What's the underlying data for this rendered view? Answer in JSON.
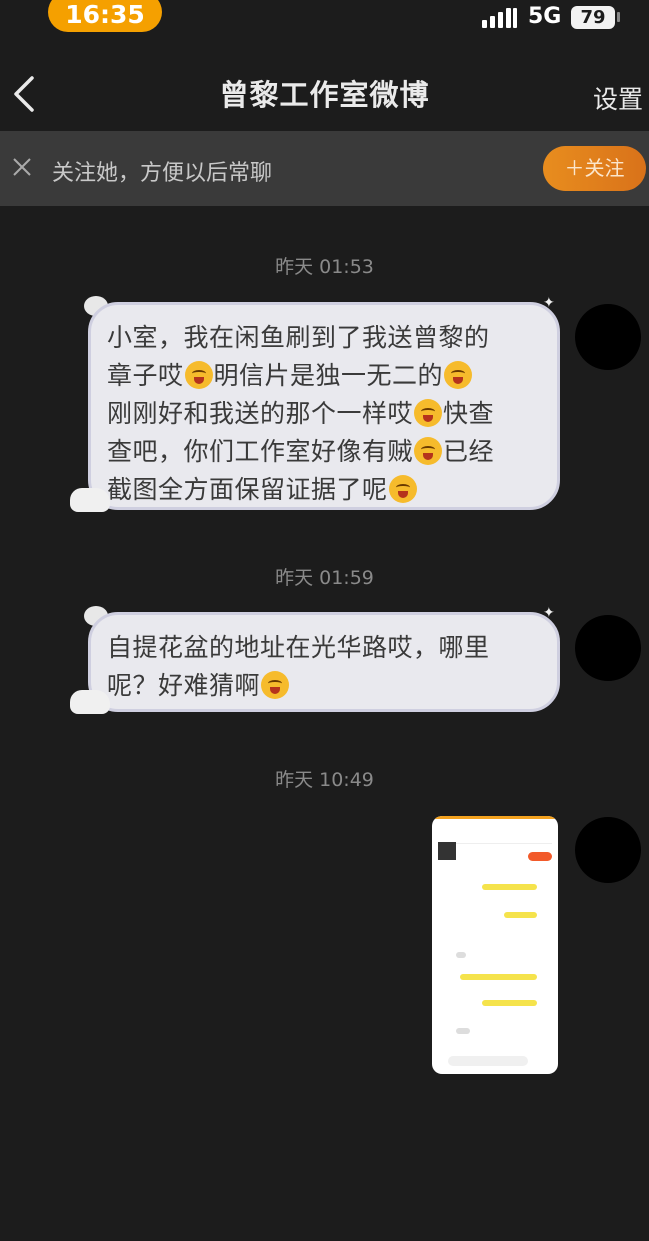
{
  "status_bar": {
    "time": "16:35",
    "network": "5G",
    "battery": "79"
  },
  "nav": {
    "title": "曾黎工作室微博",
    "settings_label": "设置"
  },
  "follow_bar": {
    "prompt": "关注她，方便以后常聊",
    "follow_label": "＋关注"
  },
  "messages": [
    {
      "timestamp": "昨天 01:53",
      "text": [
        "小室，我在闲鱼刷到了我送曾黎的",
        "章子哎",
        "明信片是独一无二的",
        "刚刚好和我送的那个一样哎",
        "快查",
        "查吧，你们工作室好像有贼",
        "已经",
        "截图全方面保留证据了呢"
      ]
    },
    {
      "timestamp": "昨天 01:59",
      "text": [
        "自提花盆的地址在光华路哎，哪里",
        "呢？好难猜啊"
      ]
    },
    {
      "timestamp": "昨天 10:49"
    }
  ],
  "colors": {
    "background": "#1c1c1c",
    "bubble": "#e9e9ee",
    "accent": "#f5a000"
  }
}
